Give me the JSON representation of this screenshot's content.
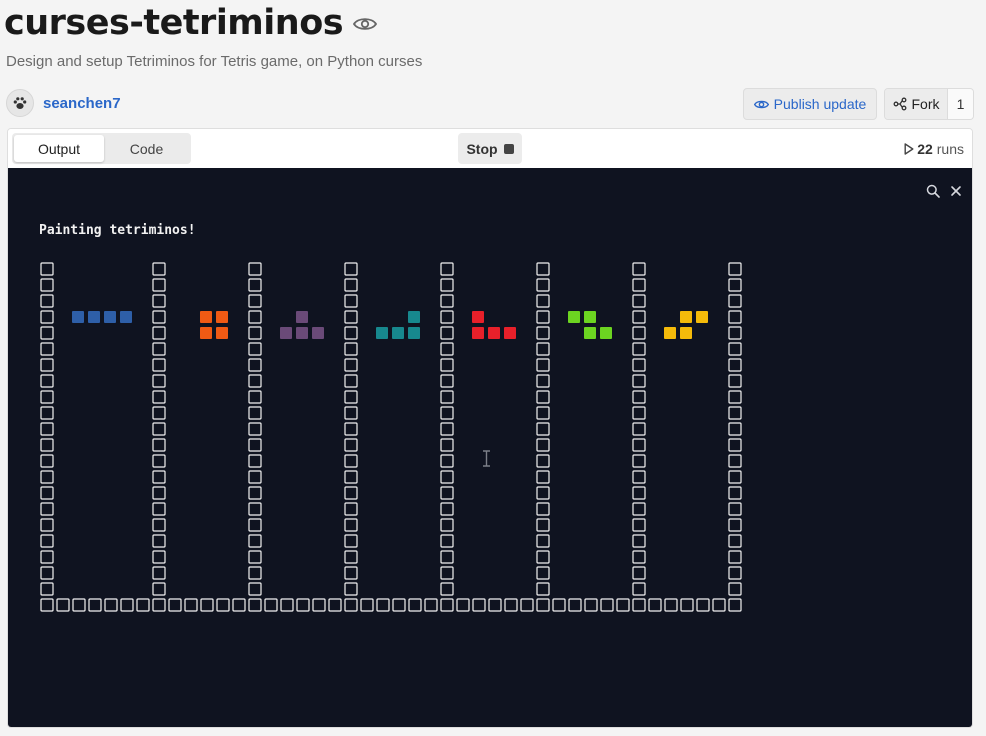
{
  "repl": {
    "title": "curses-tetriminos",
    "description": "Design and setup Tetriminos for Tetris game, on Python curses",
    "author": "seanchen7"
  },
  "actions": {
    "publish_label": "Publish update",
    "fork_label": "Fork",
    "fork_count": "1"
  },
  "toolbar": {
    "tabs": [
      "Output",
      "Code"
    ],
    "active_tab": "Output",
    "stop_label": "Stop",
    "runs_count": "22",
    "runs_label": "runs"
  },
  "terminal": {
    "message": "Painting tetriminos!",
    "border_glyph": "□",
    "wall_columns": 8,
    "board_rows": 21,
    "floor_cells": 44,
    "pieces": [
      {
        "shape": "I",
        "color": "#2e5fa8",
        "cells": [
          [
            0,
            0
          ],
          [
            1,
            0
          ],
          [
            2,
            0
          ],
          [
            3,
            0
          ]
        ]
      },
      {
        "shape": "O",
        "color": "#f05a14",
        "cells": [
          [
            0,
            0
          ],
          [
            1,
            0
          ],
          [
            0,
            1
          ],
          [
            1,
            1
          ]
        ]
      },
      {
        "shape": "T",
        "color": "#6a4a78",
        "cells": [
          [
            1,
            0
          ],
          [
            0,
            1
          ],
          [
            1,
            1
          ],
          [
            2,
            1
          ]
        ]
      },
      {
        "shape": "L",
        "color": "#17888e",
        "cells": [
          [
            2,
            0
          ],
          [
            0,
            1
          ],
          [
            1,
            1
          ],
          [
            2,
            1
          ]
        ]
      },
      {
        "shape": "J",
        "color": "#e8202a",
        "cells": [
          [
            0,
            0
          ],
          [
            0,
            1
          ],
          [
            1,
            1
          ],
          [
            2,
            1
          ]
        ]
      },
      {
        "shape": "Z",
        "color": "#6cd421",
        "cells": [
          [
            0,
            0
          ],
          [
            1,
            0
          ],
          [
            1,
            1
          ],
          [
            2,
            1
          ]
        ]
      },
      {
        "shape": "S",
        "color": "#f5bb0a",
        "cells": [
          [
            1,
            0
          ],
          [
            2,
            0
          ],
          [
            0,
            1
          ],
          [
            1,
            1
          ]
        ]
      }
    ]
  },
  "colors": {
    "accent": "#2a67c9",
    "terminal_bg": "#0f1320",
    "terminal_fg": "#f2f2f2"
  },
  "icons": {
    "title_icon": "eye-icon",
    "publish_icon": "eye-icon",
    "fork_icon": "fork-icon",
    "run_icon": "play-icon",
    "stop_icon": "stop-square-icon",
    "terminal_search": "search-icon",
    "terminal_close": "close-icon"
  }
}
